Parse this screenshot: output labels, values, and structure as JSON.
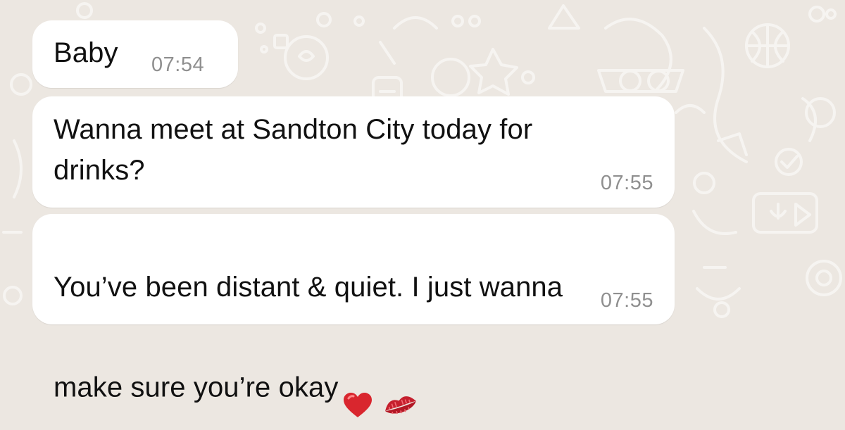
{
  "chat": {
    "messages": [
      {
        "text": "Baby",
        "time": "07:54"
      },
      {
        "text": "Wanna meet at Sandton City today for\ndrinks?",
        "time": "07:55"
      },
      {
        "text_line1": "You’ve been distant & quiet. I just wanna",
        "text_line2": "make sure you’re okay",
        "emojis": [
          "heart-emoji",
          "kiss-mark-emoji"
        ],
        "time": "07:55"
      }
    ]
  },
  "colors": {
    "background": "#ece7e1",
    "bubble": "#ffffff",
    "text": "#111111",
    "timestamp": "#8f8f8f",
    "heart": "#d9262e",
    "lips": "#c51f2d"
  }
}
